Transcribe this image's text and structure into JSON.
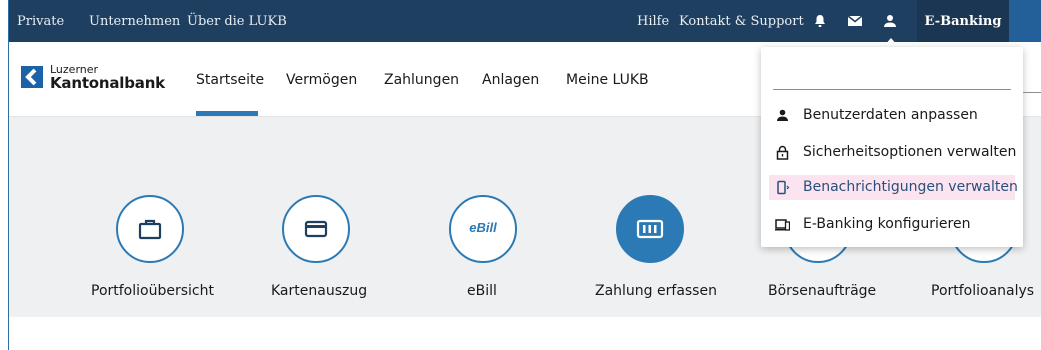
{
  "topbar": {
    "links": [
      "Private",
      "Unternehmen",
      "Über die LUKB"
    ],
    "hilfe": "Hilfe",
    "kontakt": "Kontakt & Support",
    "ebanking": "E-Banking",
    "icons": [
      "bell-icon",
      "mail-icon",
      "user-icon"
    ]
  },
  "logo": {
    "line1": "Luzerner",
    "line2": "Kantonalbank"
  },
  "nav": {
    "items": [
      "Startseite",
      "Vermögen",
      "Zahlungen",
      "Anlagen",
      "Meine LUKB"
    ],
    "active": "Startseite"
  },
  "tiles": [
    {
      "label": "Portfolioübersicht",
      "icon": "briefcase-icon"
    },
    {
      "label": "Kartenauszug",
      "icon": "card-icon"
    },
    {
      "label": "eBill",
      "icon": "ebill-icon",
      "icon_text": "eBill"
    },
    {
      "label": "Zahlung erfassen",
      "icon": "payment-slip-icon"
    },
    {
      "label": "Börsenaufträge",
      "icon": "exchange-icon"
    },
    {
      "label": "Portfolioanalys",
      "icon": "analysis-icon"
    }
  ],
  "dropdown": {
    "items": [
      {
        "label": "Benutzerdaten anpassen",
        "icon": "user-icon"
      },
      {
        "label": "Sicherheitsoptionen verwalten",
        "icon": "lock-icon"
      },
      {
        "label": "Benachrichtigungen verwalten",
        "icon": "phone-notification-icon",
        "highlighted": true
      },
      {
        "label": "E-Banking konfigurieren",
        "icon": "devices-icon"
      }
    ]
  },
  "colors": {
    "topbar": "#1e3f5f",
    "accent": "#2b7ab5",
    "highlight": "#fbe3ef",
    "content_bg": "#eef0f2"
  }
}
